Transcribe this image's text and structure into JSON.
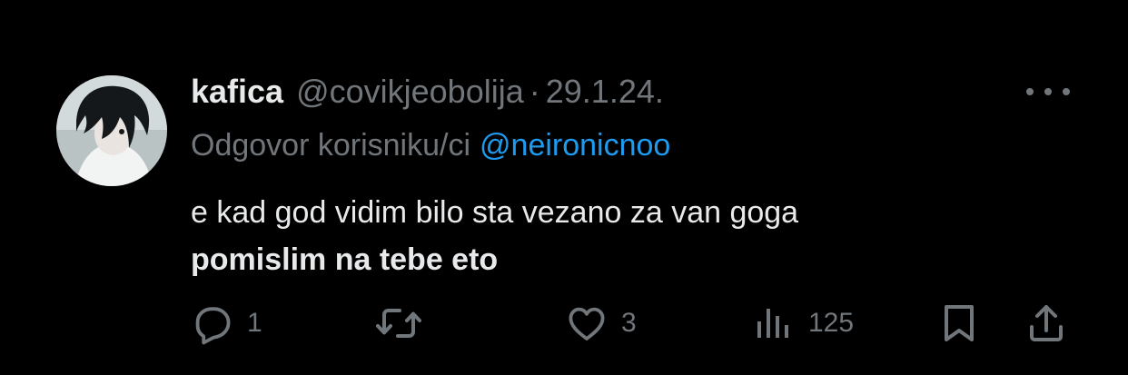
{
  "tweet": {
    "author_name": "kafica",
    "handle": "@covikjeobolija",
    "separator": "·",
    "date": "29.1.24.",
    "reply_prefix": "Odgovor korisniku/ci",
    "reply_mention": "@neironicnoo",
    "text_line1": "e kad god vidim bilo sta vezano za van goga",
    "text_line2": "pomislim na tebe eto",
    "avatar_icon": "profile-avatar"
  },
  "actions": {
    "reply_count": "1",
    "retweet_count": "",
    "like_count": "3",
    "views_count": "125",
    "reply_icon": "comment-icon",
    "retweet_icon": "retweet-icon",
    "like_icon": "heart-icon",
    "views_icon": "analytics-icon",
    "bookmark_icon": "bookmark-icon",
    "share_icon": "share-icon"
  },
  "colors": {
    "background": "#000000",
    "primary_text": "#e7e9ea",
    "secondary_text": "#71767b",
    "accent": "#1d9bf0"
  }
}
